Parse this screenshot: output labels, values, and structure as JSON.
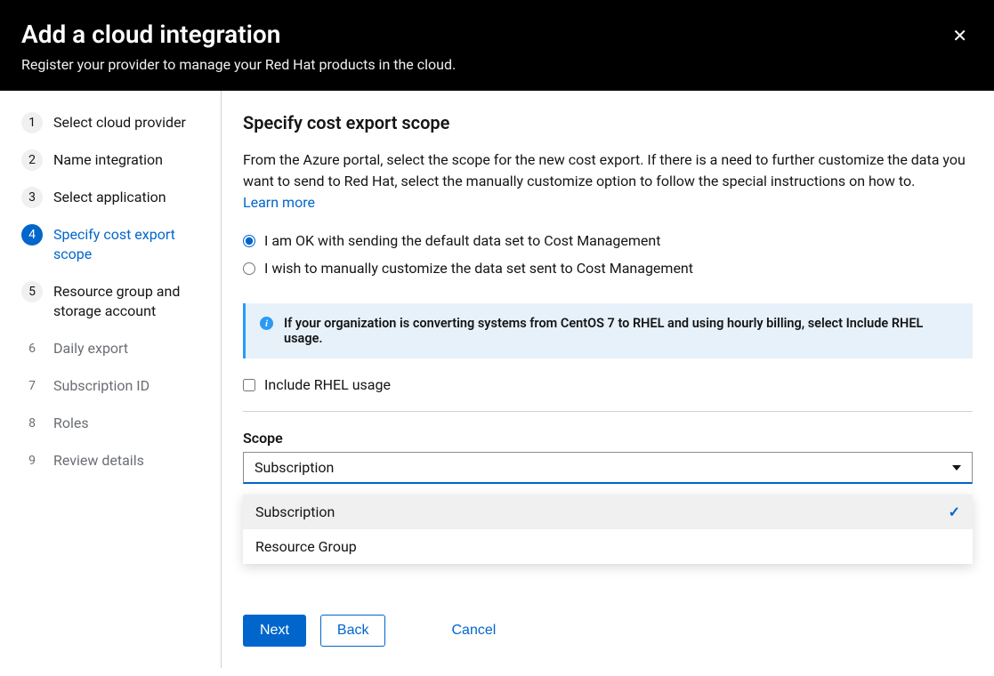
{
  "header": {
    "title": "Add a cloud integration",
    "subtitle": "Register your provider to manage your Red Hat products in the cloud."
  },
  "steps": [
    {
      "num": "1",
      "label": "Select cloud provider",
      "state": "past"
    },
    {
      "num": "2",
      "label": "Name integration",
      "state": "past"
    },
    {
      "num": "3",
      "label": "Select application",
      "state": "past"
    },
    {
      "num": "4",
      "label": "Specify cost export scope",
      "state": "active"
    },
    {
      "num": "5",
      "label": "Resource group and storage account",
      "state": "past"
    },
    {
      "num": "6",
      "label": "Daily export",
      "state": "future"
    },
    {
      "num": "7",
      "label": "Subscription ID",
      "state": "future"
    },
    {
      "num": "8",
      "label": "Roles",
      "state": "future"
    },
    {
      "num": "9",
      "label": "Review details",
      "state": "future"
    }
  ],
  "main": {
    "heading": "Specify cost export scope",
    "description": "From the Azure portal, select the scope for the new cost export. If there is a need to further customize the data you want to send to Red Hat, select the manually customize option to follow the special instructions on how to.",
    "learn_more": "Learn more",
    "radio_default": "I am OK with sending the default data set to Cost Management",
    "radio_custom": "I wish to manually customize the data set sent to Cost Management",
    "alert": "If your organization is converting systems from CentOS 7 to RHEL and using hourly billing, select Include RHEL usage.",
    "checkbox_rhel": "Include RHEL usage",
    "scope_label": "Scope",
    "scope_selected": "Subscription",
    "scope_options": [
      {
        "label": "Subscription",
        "selected": true
      },
      {
        "label": "Resource Group",
        "selected": false
      }
    ]
  },
  "footer": {
    "next": "Next",
    "back": "Back",
    "cancel": "Cancel"
  }
}
